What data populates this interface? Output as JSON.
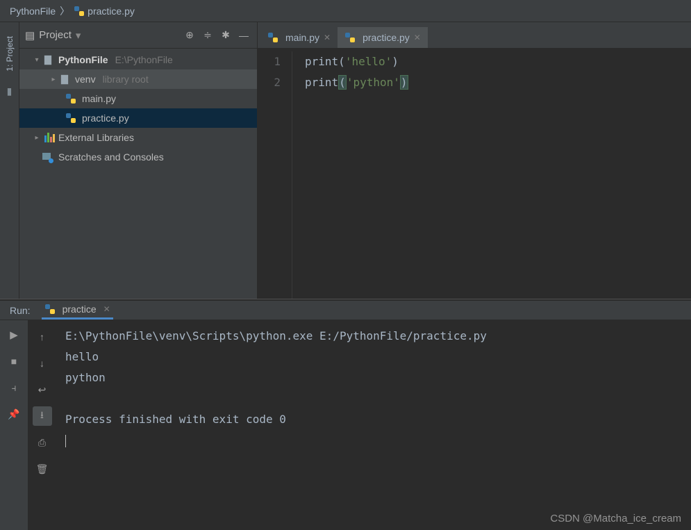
{
  "breadcrumb": {
    "root": "PythonFile",
    "file": "practice.py"
  },
  "sidebar": {
    "label": "1: Project"
  },
  "project": {
    "title": "Project",
    "root_name": "PythonFile",
    "root_path": "E:\\PythonFile",
    "venv_name": "venv",
    "venv_hint": "library root",
    "files": [
      "main.py",
      "practice.py"
    ],
    "external": "External Libraries",
    "scratches": "Scratches and Consoles"
  },
  "tabs": [
    {
      "label": "main.py",
      "active": false
    },
    {
      "label": "practice.py",
      "active": true
    }
  ],
  "code": {
    "lines": [
      {
        "num": "1",
        "fn": "print",
        "str": "'hello'",
        "hl": false
      },
      {
        "num": "2",
        "fn": "print",
        "str": "'python'",
        "hl": true
      }
    ]
  },
  "run": {
    "label": "Run:",
    "tab": "practice",
    "output": "E:\\PythonFile\\venv\\Scripts\\python.exe E:/PythonFile/practice.py\nhello\npython\n\nProcess finished with exit code 0"
  },
  "watermark": "CSDN @Matcha_ice_cream"
}
